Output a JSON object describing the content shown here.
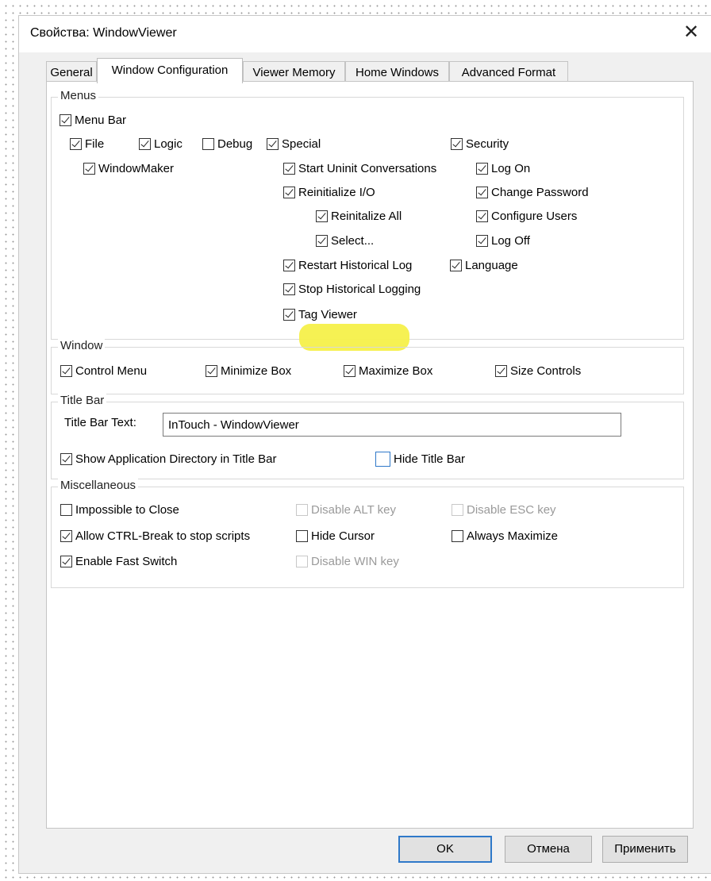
{
  "window": {
    "title": "Свойства: WindowViewer"
  },
  "tabs": [
    "General",
    "Window Configuration",
    "Viewer Memory",
    "Home Windows",
    "Advanced Format"
  ],
  "menus": {
    "label": "Menus",
    "menu_bar": "Menu Bar",
    "file": "File",
    "logic": "Logic",
    "debug": "Debug",
    "special": "Special",
    "security": "Security",
    "windowmaker": "WindowMaker",
    "start_uninit": "Start Uninit Conversations",
    "log_on": "Log On",
    "reinitialize_io": "Reinitialize I/O",
    "change_password": "Change Password",
    "reinitialize_all": "Reinitalize All",
    "configure_users": "Configure Users",
    "select": "Select...",
    "log_off": "Log Off",
    "restart_historical": "Restart Historical Log",
    "language": "Language",
    "stop_historical": "Stop Historical Logging",
    "tag_viewer": "Tag Viewer"
  },
  "window_group": {
    "label": "Window",
    "control_menu": "Control Menu",
    "minimize_box": "Minimize Box",
    "maximize_box": "Maximize Box",
    "size_controls": "Size Controls"
  },
  "title_bar": {
    "label": "Title Bar",
    "text_label": "Title Bar Text:",
    "text_value": "InTouch - WindowViewer",
    "show_app_dir": "Show Application Directory in Title Bar",
    "hide_title_bar": "Hide Title Bar"
  },
  "misc": {
    "label": "Miscellaneous",
    "impossible_close": "Impossible to Close",
    "disable_alt": "Disable ALT key",
    "disable_esc": "Disable ESC key",
    "allow_ctrl_break": "Allow CTRL-Break to stop scripts",
    "hide_cursor": "Hide Cursor",
    "always_maximize": "Always Maximize",
    "fast_switch": "Enable Fast Switch",
    "disable_win": "Disable WIN key"
  },
  "buttons": {
    "ok": "OK",
    "cancel": "Отмена",
    "apply": "Применить"
  },
  "colors": {
    "highlight": "#f6f04a",
    "accent": "#2f79c9"
  }
}
